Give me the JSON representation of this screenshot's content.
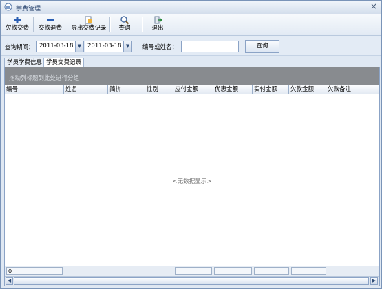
{
  "window": {
    "title": "学费管理",
    "close_glyph": "×"
  },
  "toolbar": {
    "buttons": [
      {
        "label": "欠款交费",
        "icon": "plus-icon"
      },
      {
        "label": "交款退费",
        "icon": "minus-icon"
      },
      {
        "label": "导出交费记录",
        "icon": "export-icon"
      },
      {
        "label": "查询",
        "icon": "search-icon"
      },
      {
        "label": "退出",
        "icon": "exit-icon"
      }
    ]
  },
  "filter": {
    "period_label": "查询期间：",
    "date_from": "2011-03-18",
    "date_to": "2011-03-18",
    "id_name_label": "编号或姓名：",
    "id_name_value": "",
    "query_button": "查询"
  },
  "tabs": [
    {
      "label": "学员学费信息",
      "active": false
    },
    {
      "label": "学员交费记录",
      "active": true
    }
  ],
  "grid": {
    "group_hint": "拖动列标题到此处进行分组",
    "columns": [
      "编号",
      "姓名",
      "简拼",
      "性别",
      "应付金额",
      "优惠金额",
      "实付金额",
      "欠款金额",
      "欠款备注"
    ],
    "rows": [],
    "empty_text": "<无数据显示>",
    "footer": {
      "count": "0"
    }
  },
  "colors": {
    "accent": "#1d3a66",
    "group_area": "#888b8f"
  }
}
